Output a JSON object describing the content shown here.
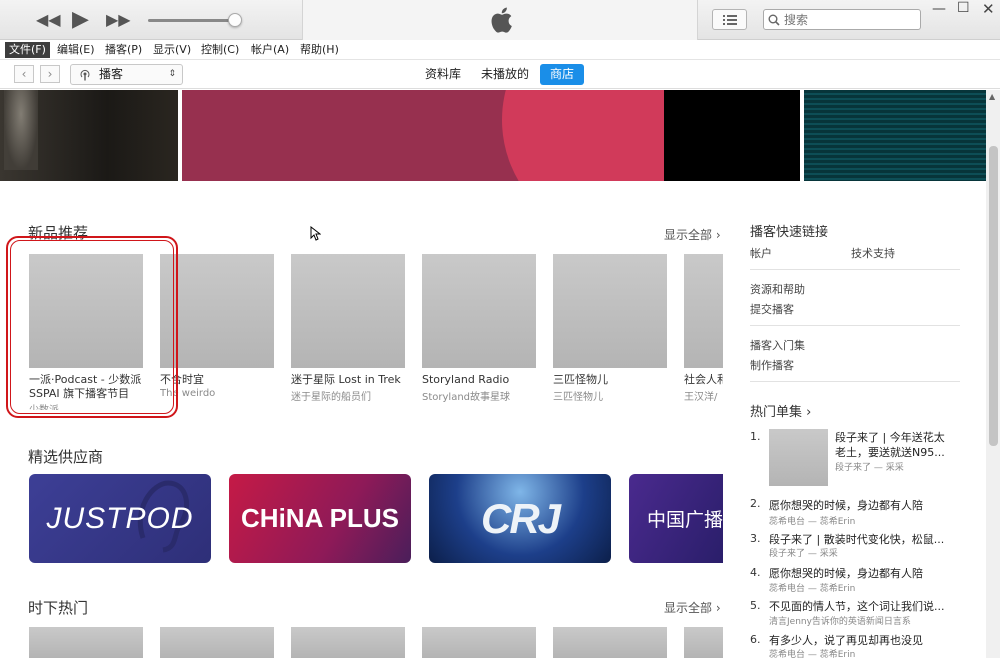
{
  "player": {
    "search_placeholder": "搜索"
  },
  "menu": {
    "items": [
      "文件(F)",
      "编辑(E)",
      "播客(P)",
      "显示(V)",
      "控制(C)",
      "帐户(A)",
      "帮助(H)"
    ]
  },
  "nav": {
    "library_select": "播客",
    "tabs": [
      "资料库",
      "未播放的",
      "商店"
    ],
    "active_tab": "商店"
  },
  "sections": {
    "new_title": "新品推荐",
    "show_all": "显示全部",
    "new_items": [
      {
        "title": "一派·Podcast - 少数派",
        "title2": "SSPAI 旗下播客节目",
        "sub": "少数派"
      },
      {
        "title": "不合时宜",
        "title2": "",
        "sub": "The weirdo"
      },
      {
        "title": "迷于星际 Lost in Trek",
        "title2": "",
        "sub": "迷于星际的船员们"
      },
      {
        "title": "Storyland Radio",
        "title2": "",
        "sub": "Storyland故事星球"
      },
      {
        "title": "三匹怪物儿",
        "title2": "",
        "sub": "三匹怪物儿"
      },
      {
        "title": "社会人和",
        "title2": "",
        "sub": "王汉洋/"
      }
    ],
    "providers_title": "精选供应商",
    "providers": [
      "JUSTPOD",
      "CHiNA PLUS",
      "CRJ",
      "中国广播"
    ],
    "trending_title": "时下热门"
  },
  "sidebar": {
    "quick_links_title": "播客快速链接",
    "links": [
      "帐户",
      "技术支持",
      "资源和帮助",
      "提交播客",
      "播客入门集",
      "制作播客"
    ],
    "hot_title": "热门单集",
    "hot_items": [
      {
        "num": "1.",
        "title": "段子来了 | 今年送花太",
        "title2": "老土，要送就送N95...",
        "sub": "段子来了 — 采采"
      },
      {
        "num": "2.",
        "title": "愿你想哭的时候，身边都有人陪",
        "title2": "",
        "sub": "蕊希电台 — 蕊希Erin"
      },
      {
        "num": "3.",
        "title": "段子来了 | 散装时代变化快，松鼠...",
        "title2": "",
        "sub": "段子来了 — 采采"
      },
      {
        "num": "4.",
        "title": "愿你想哭的时候，身边都有人陪",
        "title2": "",
        "sub": "蕊希电台 — 蕊希Erin"
      },
      {
        "num": "5.",
        "title": "不见面的情人节，这个词让我们说...",
        "title2": "",
        "sub": "清言Jenny告诉你的英语新闻日言系"
      },
      {
        "num": "6.",
        "title": "有多少人，说了再见却再也没见",
        "title2": "",
        "sub": "蕊希电台 — 蕊希Erin"
      }
    ]
  },
  "colors": {
    "accent": "#1a8ee8",
    "highlight": "#d0161a",
    "justpod_bg": "#3a3a8e",
    "chinaplus_bg": "#b0164a",
    "crj_bg": "#1d3f8a"
  }
}
